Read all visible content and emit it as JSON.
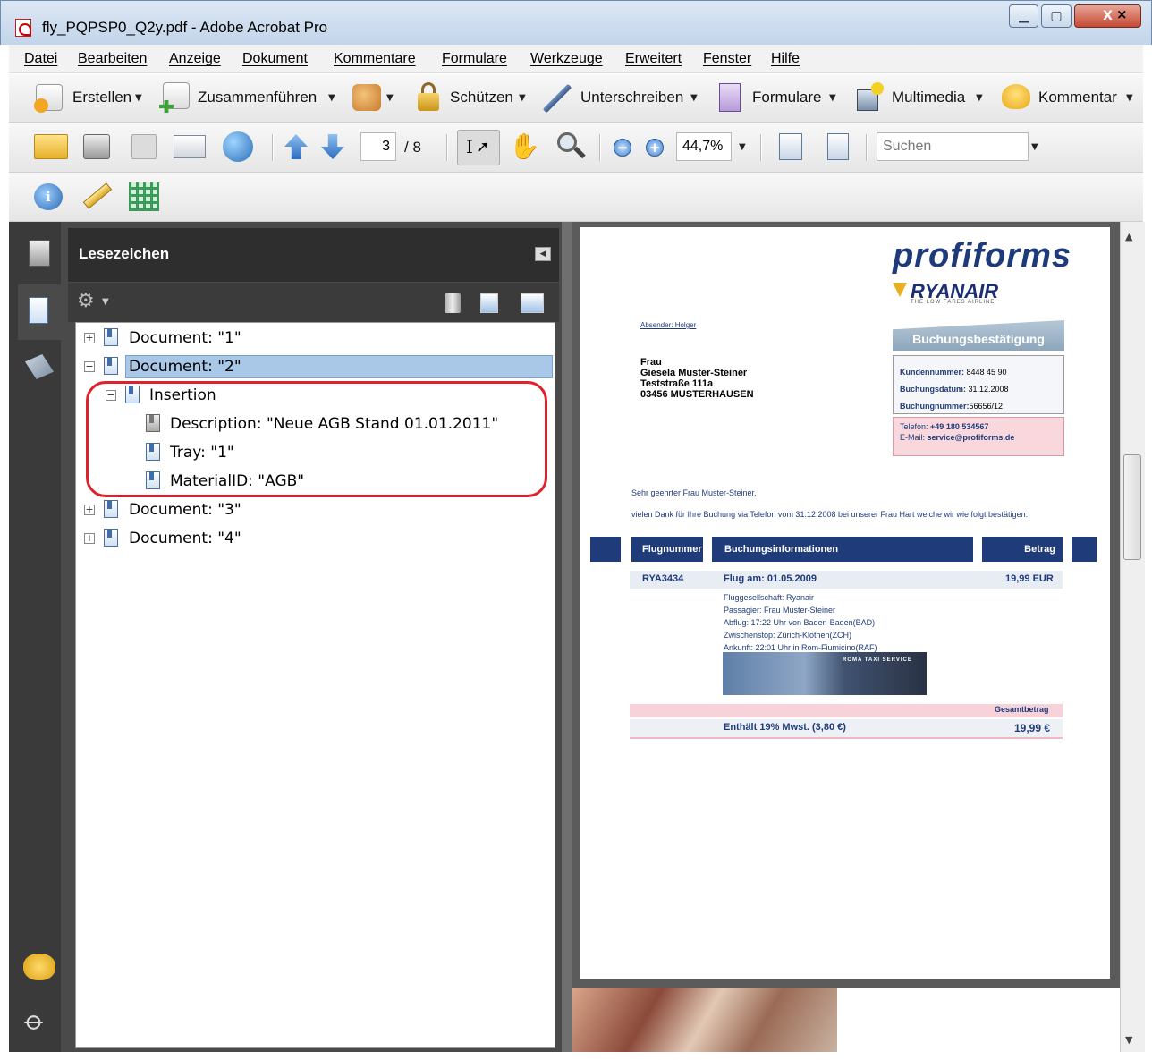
{
  "window": {
    "title": "fly_PQPSP0_Q2y.pdf - Adobe Acrobat Pro",
    "min": "▁",
    "max": "▢",
    "close": "X"
  },
  "menu": [
    "Datei",
    "Bearbeiten",
    "Anzeige",
    "Dokument",
    "Kommentare",
    "Formulare",
    "Werkzeuge",
    "Erweitert",
    "Fenster",
    "Hilfe"
  ],
  "menu_close": "×",
  "toolbar1": {
    "create": "Erstellen",
    "combine": "Zusammenführen",
    "protect": "Schützen",
    "sign": "Unterschreiben",
    "forms": "Formulare",
    "multimedia": "Multimedia",
    "comment": "Kommentar"
  },
  "toolbar2": {
    "page": "3",
    "page_total": "/ 8",
    "zoom": "44,7%",
    "search_placeholder": "Suchen"
  },
  "panel": {
    "title": "Lesezeichen"
  },
  "tree": {
    "doc1": "Document: \"1\"",
    "doc2": "Document: \"2\"",
    "insertion": "Insertion",
    "description": "Description: \"Neue AGB Stand 01.01.2011\"",
    "tray": "Tray: \"1\"",
    "material": "MaterialID: \"AGB\"",
    "doc3": "Document: \"3\"",
    "doc4": "Document: \"4\""
  },
  "pdf": {
    "brand": "profiforms",
    "airline": "RYANAIR",
    "airline_tagline": "THE LOW FARES AIRLINE",
    "sender": "Absender: Holger",
    "addr1": "Frau",
    "addr2": "Giesela Muster-Steiner",
    "addr3": "Teststraße 111a",
    "addr4": "03456 MUSTERHAUSEN",
    "booking_head": "Buchungsbestätigung",
    "cust_label": "Kundennummer:",
    "cust_val": "8448 45 90",
    "date_label": "Buchungsdatum:",
    "date_val": "31.12.2008",
    "num_label": "Buchungnummer:",
    "num_val": "56656/12",
    "tel_label": "Telefon:",
    "tel_val": "+49 180 534567",
    "mail_label": "E-Mail:",
    "mail_val": "service@profiforms.de",
    "salutation": "Sehr geehrter Frau Muster-Steiner,",
    "intro": "vielen Dank für Ihre Buchung via Telefon vom 31.12.2008 bei unserer Frau Hart welche wir wie folgt bestätigen:",
    "col1": "Flugnummer",
    "col2": "Buchungsinformationen",
    "col3": "Betrag",
    "flight_no": "RYA3434",
    "flight_date": "Flug am: 01.05.2009",
    "price": "19,99 EUR",
    "d1": "Fluggesellschaft: Ryanair",
    "d2": "Passagier: Frau Muster-Steiner",
    "d3": "Abflug: 17:22 Uhr von Baden-Baden(BAD)",
    "d4": "Zwischenstop: Zürich-Klothen(ZCH)",
    "d5": "Ankunft: 22:01 Uhr in Rom-Fiumicino(RAF)",
    "ad_text": "ROMA TAXI SERVICE",
    "total_label": "Gesamtbetrag",
    "vat": "Enthält 19% Mwst. (3,80 €)",
    "total": "19,99 €"
  }
}
